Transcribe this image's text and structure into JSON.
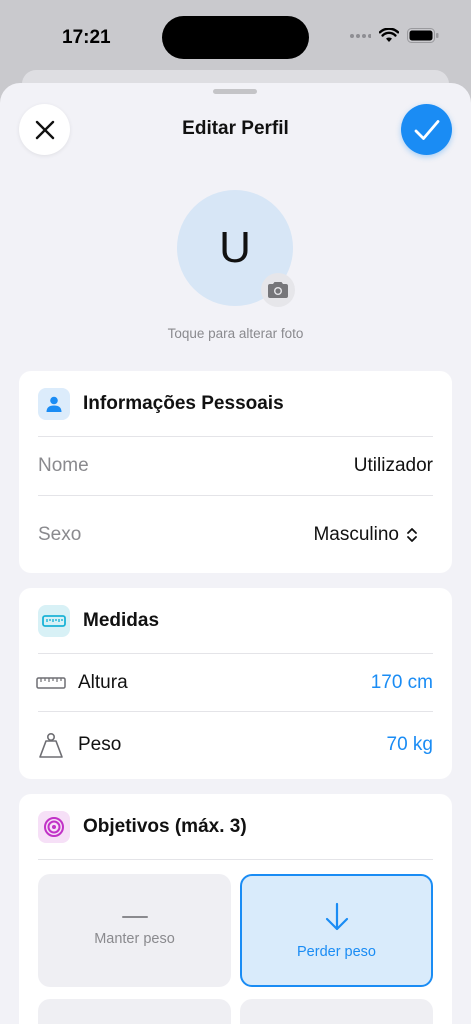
{
  "status": {
    "time": "17:21"
  },
  "nav": {
    "title": "Editar Perfil",
    "close_icon": "close-icon",
    "confirm_icon": "checkmark-icon"
  },
  "avatar": {
    "initial": "U",
    "hint": "Toque para alterar foto"
  },
  "personal": {
    "title": "Informações Pessoais",
    "name_label": "Nome",
    "name_value": "Utilizador",
    "sex_label": "Sexo",
    "sex_value": "Masculino"
  },
  "measures": {
    "title": "Medidas",
    "height_label": "Altura",
    "height_value": "170 cm",
    "weight_label": "Peso",
    "weight_value": "70 kg"
  },
  "goals": {
    "title": "Objetivos (máx. 3)",
    "items": [
      {
        "label": "Manter peso",
        "selected": false
      },
      {
        "label": "Perder peso",
        "selected": true
      }
    ]
  },
  "colors": {
    "accent": "#1a8cf4",
    "background": "#f2f2f7",
    "avatar_bg": "#d7e6f6"
  }
}
